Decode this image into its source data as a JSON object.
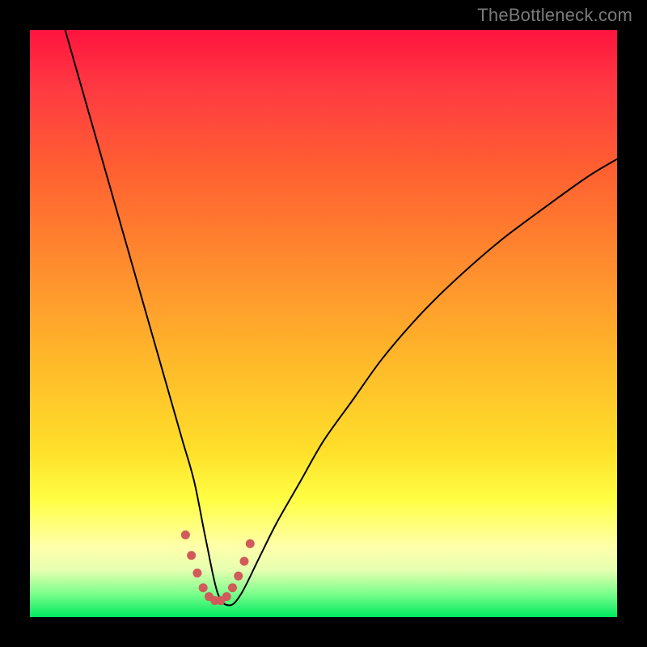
{
  "watermark": "TheBottleneck.com",
  "chart_data": {
    "type": "line",
    "title": "",
    "xlabel": "",
    "ylabel": "",
    "xlim": [
      0,
      100
    ],
    "ylim": [
      0,
      100
    ],
    "background_gradient": {
      "stops": [
        {
          "pos": 0,
          "color": "#ff143f"
        },
        {
          "pos": 0.25,
          "color": "#ff6330"
        },
        {
          "pos": 0.55,
          "color": "#ffb52a"
        },
        {
          "pos": 0.8,
          "color": "#ffff44"
        },
        {
          "pos": 0.96,
          "color": "#7cff8c"
        },
        {
          "pos": 1.0,
          "color": "#00e860"
        }
      ]
    },
    "series": [
      {
        "name": "curve",
        "stroke": "#000000",
        "stroke_width": 2,
        "x": [
          6,
          8,
          10,
          12,
          14,
          16,
          18,
          20,
          22,
          24,
          26,
          28,
          30,
          32,
          34,
          36,
          39,
          42,
          46,
          50,
          55,
          60,
          66,
          72,
          80,
          88,
          95,
          100
        ],
        "y": [
          100,
          93,
          86,
          79,
          72,
          65,
          58,
          51,
          44,
          37,
          30,
          23,
          13,
          4,
          2,
          4,
          10,
          16,
          23,
          30,
          37,
          44,
          51,
          57,
          64,
          70,
          75,
          78
        ]
      },
      {
        "name": "dotted-valley",
        "stroke": "#d15a5a",
        "stroke_width": 11,
        "dashed": true,
        "x": [
          26.5,
          27.5,
          28.5,
          29.5,
          30.5,
          31.5,
          32.5,
          33.5,
          34.5,
          35.5,
          36.5,
          37.5
        ],
        "y": [
          14.0,
          10.5,
          7.5,
          5.0,
          3.5,
          2.8,
          2.8,
          3.5,
          5.0,
          7.0,
          9.5,
          12.5
        ]
      }
    ]
  }
}
